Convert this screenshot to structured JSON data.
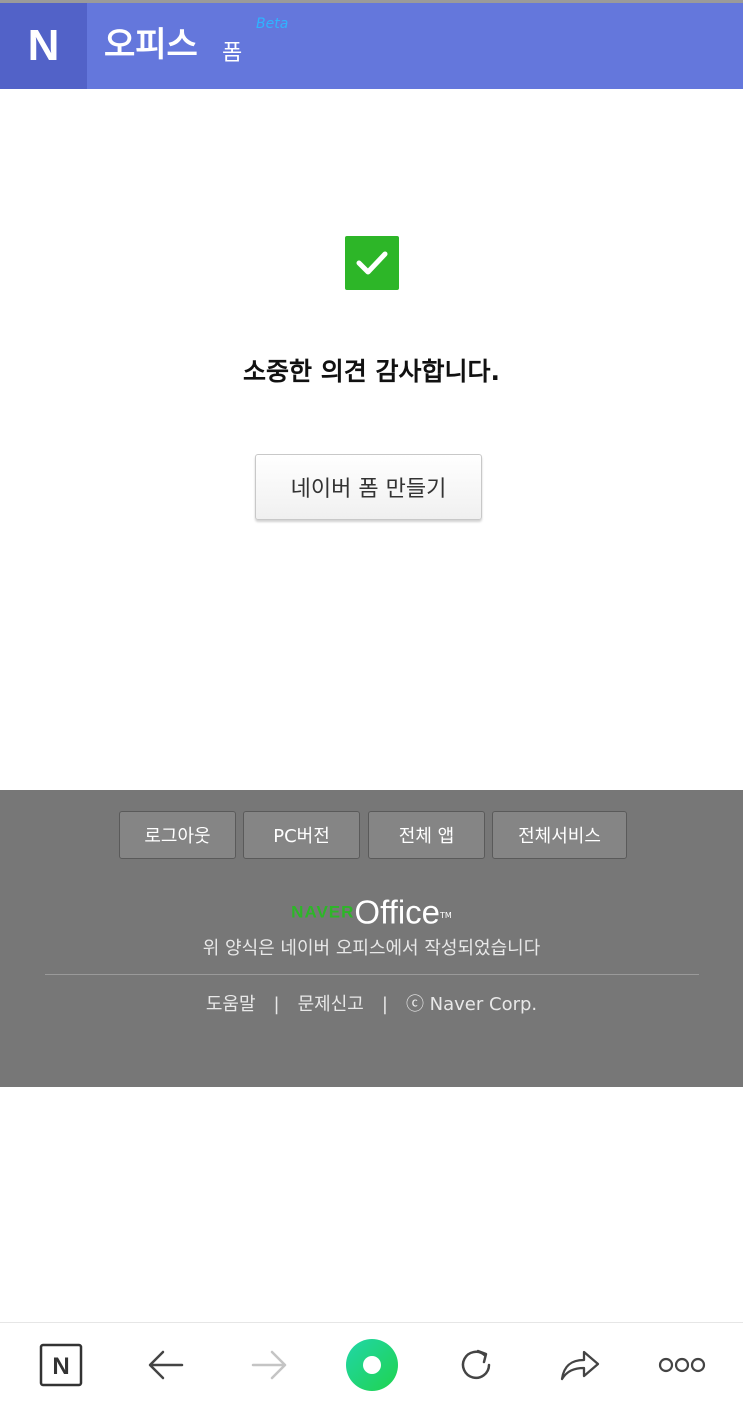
{
  "header": {
    "logo_letter": "N",
    "title": "오피스",
    "subtitle": "폼",
    "badge": "Beta",
    "colors": {
      "bar": "#6477dc",
      "logo_block": "#5262c8",
      "badge": "#2fb3ff"
    }
  },
  "main": {
    "check_icon": "checkmark-icon",
    "message": "소중한 의견 감사합니다.",
    "create_button": "네이버 폼 만들기",
    "accent": "#2db628"
  },
  "footer": {
    "buttons": [
      "로그아웃",
      "PC버전",
      "전체 앱",
      "전체서비스"
    ],
    "brand_naver": "NAVER",
    "brand_office": "Office",
    "brand_tm": "TM",
    "made_with": "위 양식은 네이버 오피스에서 작성되었습니다",
    "links": [
      "도움말",
      "문제신고",
      "ⓒ Naver Corp."
    ],
    "separator": "|",
    "background": "#777777"
  },
  "browser_nav": {
    "items": [
      "naver-home-icon",
      "back-arrow-icon",
      "forward-arrow-icon",
      "green-dot-icon",
      "refresh-icon",
      "share-icon",
      "more-icon"
    ],
    "home_letter": "N"
  }
}
